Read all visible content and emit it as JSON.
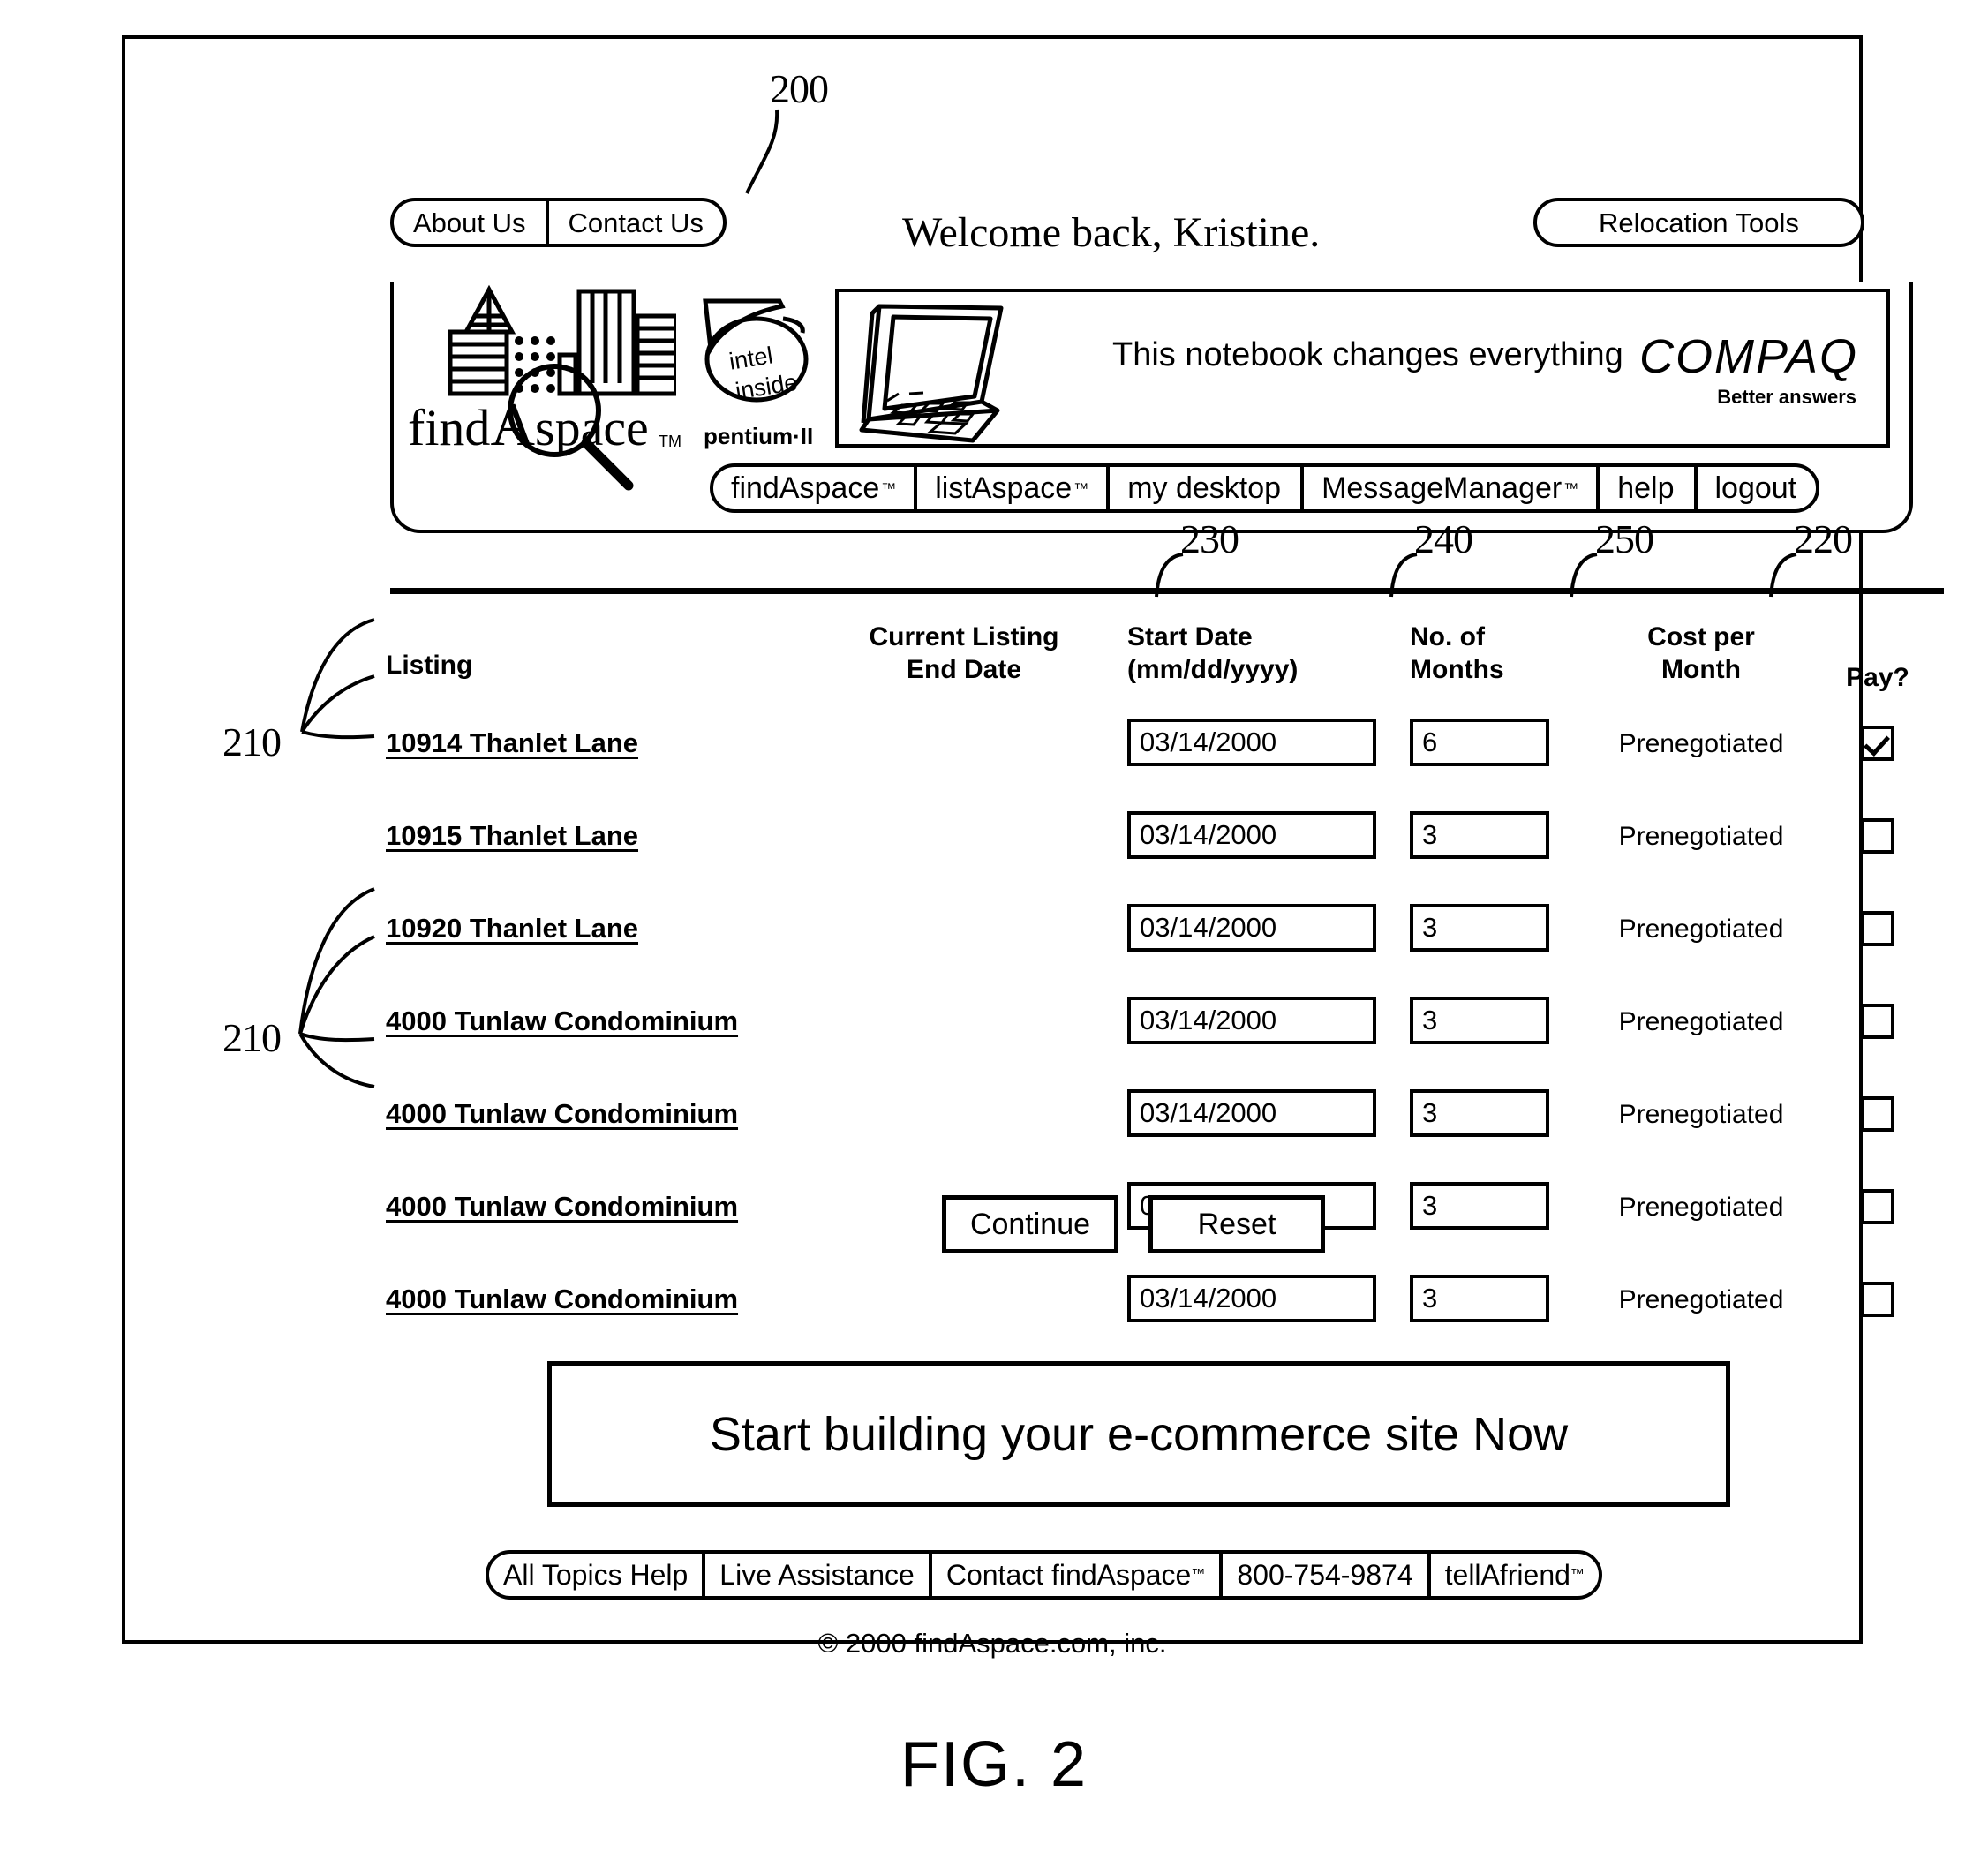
{
  "figure": {
    "caption": "FIG. 2",
    "reference_numbers": {
      "page": "200",
      "listings": "210",
      "pay_column": "220",
      "start_date_column": "230",
      "months_column": "240",
      "cost_column": "250"
    }
  },
  "topbar": {
    "about_us": "About Us",
    "contact_us": "Contact Us",
    "relocation_tools": "Relocation Tools",
    "welcome": "Welcome back, Kristine."
  },
  "brand": {
    "name_prefix": "find",
    "name_a": "A",
    "name_suffix": "space",
    "trademark": "TM",
    "skyline_icon": "city-skyline-icon",
    "magnifier_icon": "magnifying-glass-icon"
  },
  "intel": {
    "line1": "intel",
    "line2": "inside",
    "processor": "pentium·II"
  },
  "advertisement": {
    "tagline": "This notebook changes everything",
    "brand": "COMPAQ",
    "slogan": "Better answers",
    "art_icon": "laptop-notebook-icon"
  },
  "nav": {
    "items": [
      {
        "label": "findAspace",
        "tm": "™"
      },
      {
        "label": "listAspace",
        "tm": "™"
      },
      {
        "label": "my desktop",
        "tm": ""
      },
      {
        "label": "MessageManager",
        "tm": "™"
      },
      {
        "label": "help",
        "tm": ""
      },
      {
        "label": "logout",
        "tm": ""
      }
    ]
  },
  "table": {
    "headers": {
      "listing": "Listing",
      "end_date_line1": "Current Listing",
      "end_date_line2": "End Date",
      "start_date_line1": "Start Date",
      "start_date_line2": "(mm/dd/yyyy)",
      "months_line1": "No. of",
      "months_line2": "Months",
      "cost_line1": "Cost per",
      "cost_line2": "Month",
      "pay": "Pay?"
    },
    "rows": [
      {
        "listing": "10914 Thanlet Lane",
        "end_date": "",
        "start_date": "03/14/2000",
        "months": "6",
        "cost": "Prenegotiated",
        "pay": true
      },
      {
        "listing": "10915 Thanlet Lane",
        "end_date": "",
        "start_date": "03/14/2000",
        "months": "3",
        "cost": "Prenegotiated",
        "pay": false
      },
      {
        "listing": "10920 Thanlet Lane",
        "end_date": "",
        "start_date": "03/14/2000",
        "months": "3",
        "cost": "Prenegotiated",
        "pay": false
      },
      {
        "listing": "4000 Tunlaw Condominium",
        "end_date": "",
        "start_date": "03/14/2000",
        "months": "3",
        "cost": "Prenegotiated",
        "pay": false
      },
      {
        "listing": "4000 Tunlaw Condominium",
        "end_date": "",
        "start_date": "03/14/2000",
        "months": "3",
        "cost": "Prenegotiated",
        "pay": false
      },
      {
        "listing": "4000 Tunlaw Condominium",
        "end_date": "",
        "start_date": "03/14/2000",
        "months": "3",
        "cost": "Prenegotiated",
        "pay": false
      },
      {
        "listing": "4000 Tunlaw Condominium",
        "end_date": "",
        "start_date": "03/14/2000",
        "months": "3",
        "cost": "Prenegotiated",
        "pay": false
      }
    ]
  },
  "actions": {
    "continue": "Continue",
    "reset": "Reset"
  },
  "promo": {
    "text": "Start building your e-commerce site Now"
  },
  "footer": {
    "links": [
      {
        "label": "All Topics Help",
        "tm": ""
      },
      {
        "label": "Live Assistance",
        "tm": ""
      },
      {
        "label": "Contact findAspace",
        "tm": "™"
      },
      {
        "label": "800-754-9874",
        "tm": ""
      },
      {
        "label": "tellAfriend",
        "tm": "™"
      }
    ],
    "copyright": "© 2000 findAspace.com, inc."
  }
}
